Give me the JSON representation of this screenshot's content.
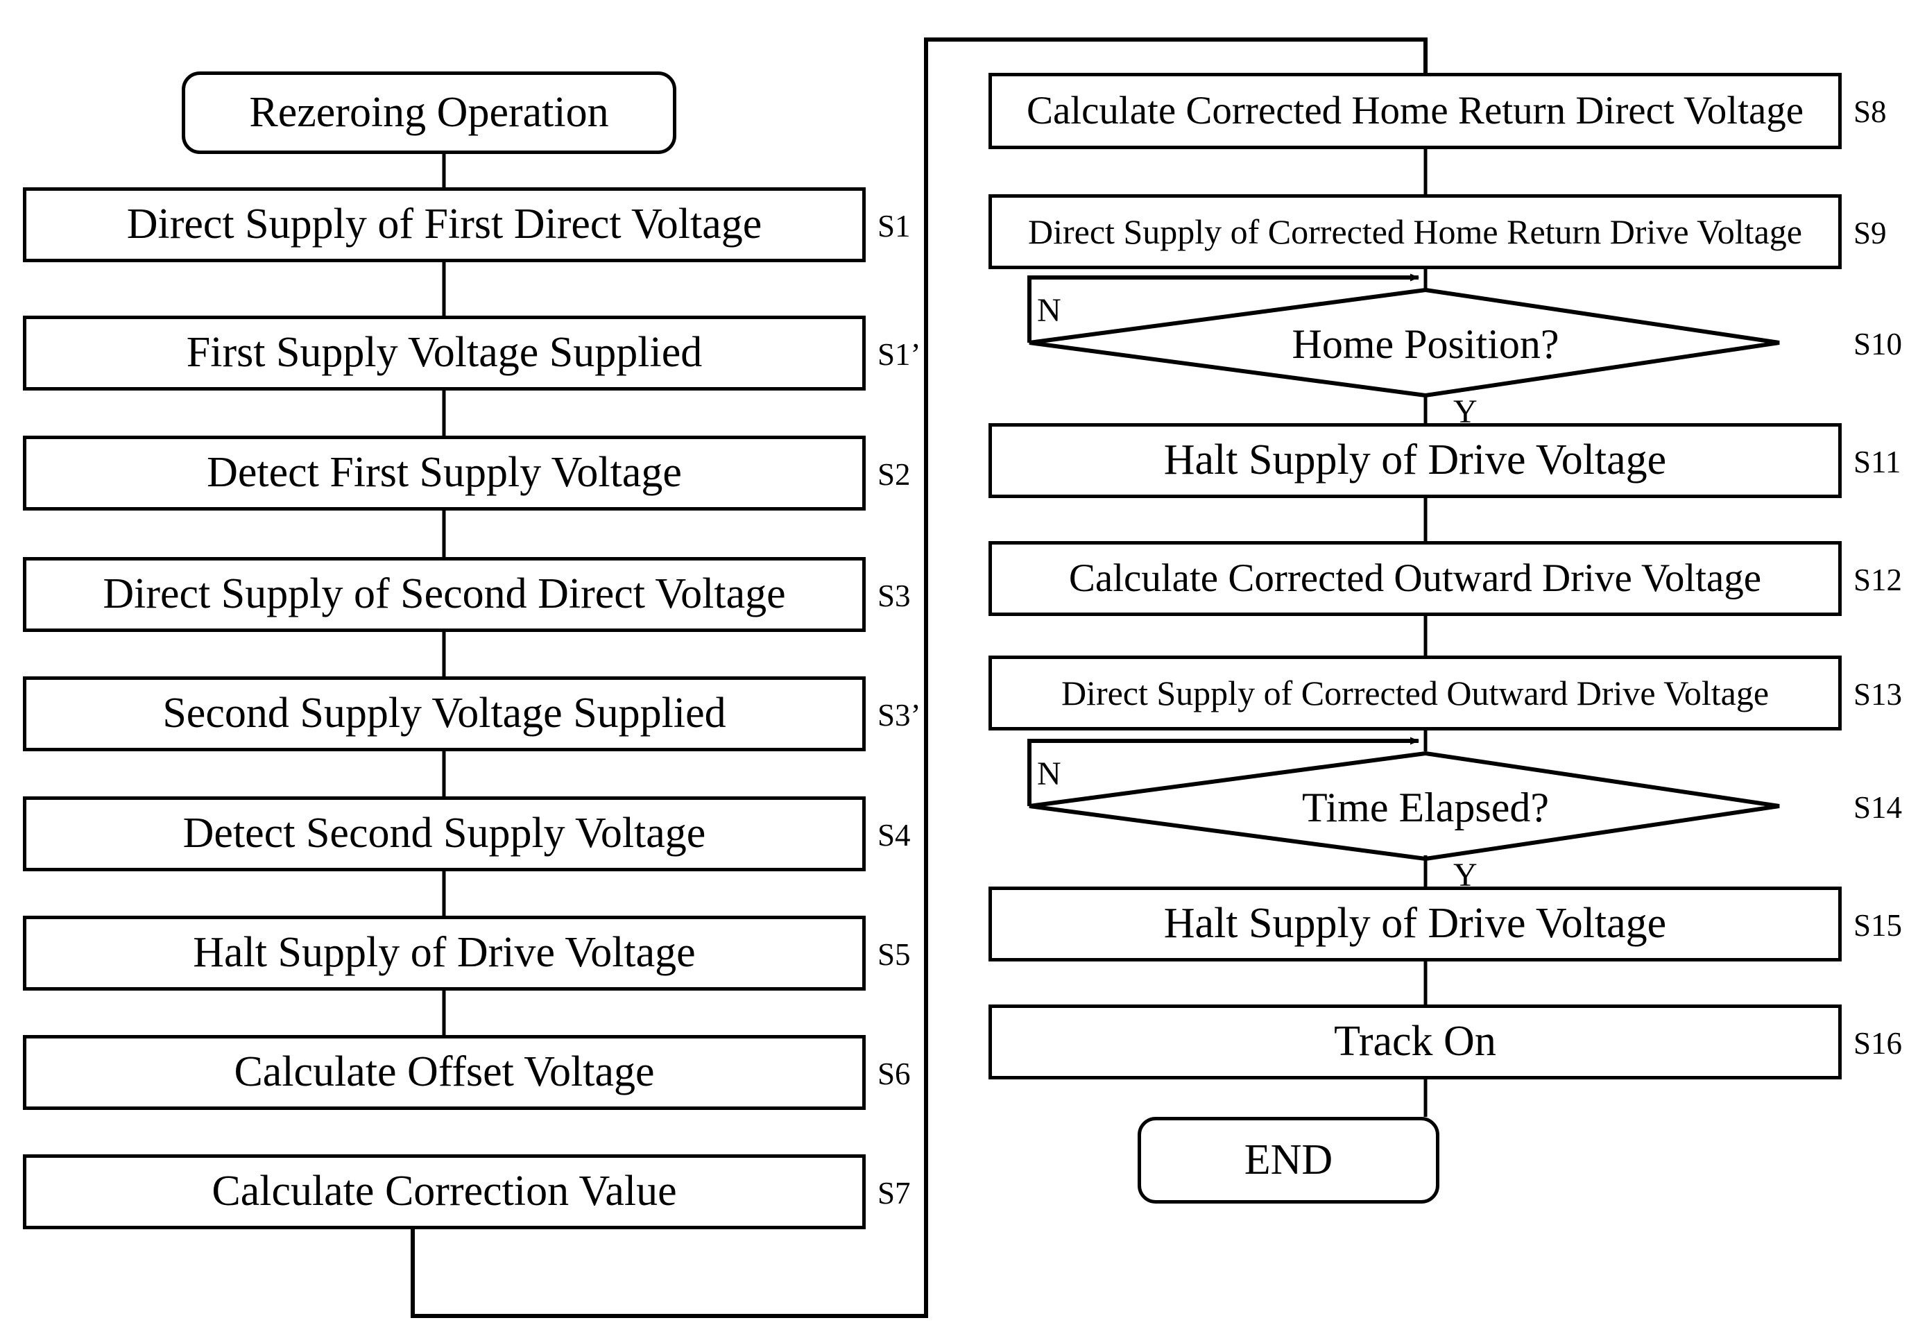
{
  "diagram": {
    "type": "flowchart",
    "title": "Rezeroing Operation Flowchart",
    "orientation": "two-column",
    "background_color": "#ffffff",
    "line_color": "#000000"
  },
  "left_column": {
    "start": {
      "label": "Rezeroing Operation",
      "shape": "terminator",
      "step": ""
    },
    "steps": [
      {
        "label": "Direct Supply of First Direct Voltage",
        "step": "S1",
        "shape": "process"
      },
      {
        "label": "First Supply Voltage Supplied",
        "step": "S1’",
        "shape": "process"
      },
      {
        "label": "Detect First Supply Voltage",
        "step": "S2",
        "shape": "process"
      },
      {
        "label": "Direct Supply of Second Direct Voltage",
        "step": "S3",
        "shape": "process"
      },
      {
        "label": "Second Supply Voltage Supplied",
        "step": "S3’",
        "shape": "process"
      },
      {
        "label": "Detect Second Supply Voltage",
        "step": "S4",
        "shape": "process"
      },
      {
        "label": "Halt Supply of Drive Voltage",
        "step": "S5",
        "shape": "process"
      },
      {
        "label": "Calculate Offset Voltage",
        "step": "S6",
        "shape": "process"
      },
      {
        "label": "Calculate Correction Value",
        "step": "S7",
        "shape": "process"
      }
    ]
  },
  "right_column": {
    "steps": [
      {
        "label": "Calculate Corrected Home Return Direct Voltage",
        "step": "S8",
        "shape": "process"
      },
      {
        "label": "Direct Supply of Corrected Home Return Drive Voltage",
        "step": "S9",
        "shape": "process"
      },
      {
        "label": "Home Position?",
        "step": "S10",
        "shape": "decision",
        "no_label": "N",
        "yes_label": "Y"
      },
      {
        "label": "Halt Supply of Drive Voltage",
        "step": "S11",
        "shape": "process"
      },
      {
        "label": "Calculate Corrected Outward Drive Voltage",
        "step": "S12",
        "shape": "process"
      },
      {
        "label": "Direct Supply of Corrected Outward Drive Voltage",
        "step": "S13",
        "shape": "process"
      },
      {
        "label": "Time Elapsed?",
        "step": "S14",
        "shape": "decision",
        "no_label": "N",
        "yes_label": "Y"
      },
      {
        "label": "Halt Supply of Drive Voltage",
        "step": "S15",
        "shape": "process"
      },
      {
        "label": "Track On",
        "step": "S16",
        "shape": "process"
      }
    ],
    "end": {
      "label": "END",
      "shape": "terminator",
      "step": ""
    }
  }
}
